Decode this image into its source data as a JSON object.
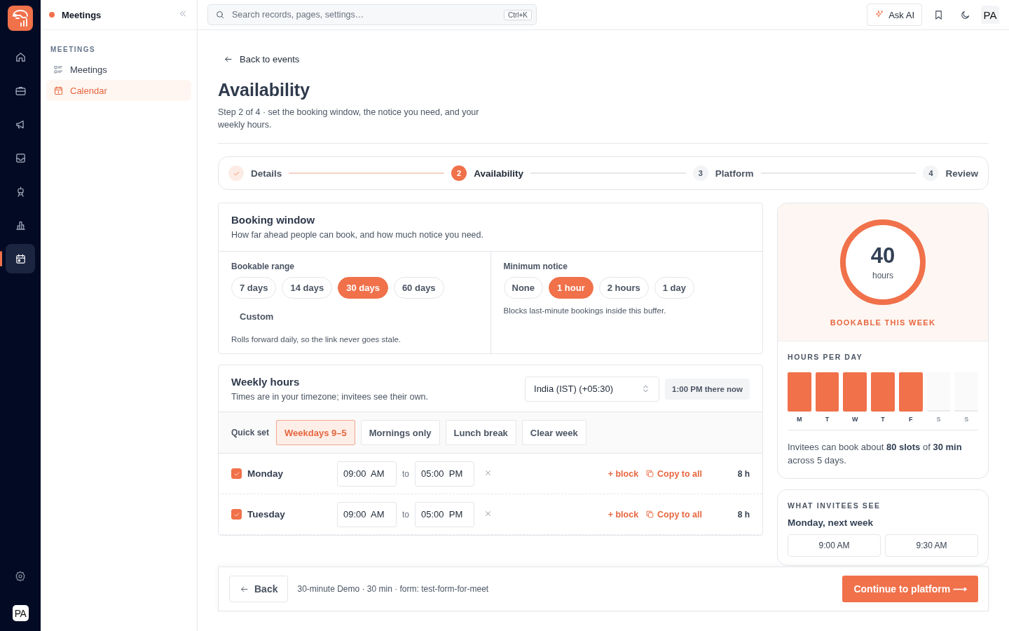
{
  "rail": {
    "items": [
      {
        "selected": false
      },
      {
        "selected": false
      },
      {
        "selected": false
      },
      {
        "selected": false
      },
      {
        "selected": false
      },
      {
        "selected": false
      },
      {
        "selected": true
      }
    ],
    "avatar": "PA"
  },
  "sidebar": {
    "title": "Meetings",
    "section": "MEETINGS",
    "items": [
      {
        "label": "Meetings",
        "selected": false
      },
      {
        "label": "Calendar",
        "selected": true
      }
    ]
  },
  "topbar": {
    "search": {
      "placeholder": "Search records, pages, settings…"
    },
    "shortcut": "Ctrl+K",
    "ask_ai": "Ask AI",
    "avatar": "PA"
  },
  "page": {
    "back_link": "Back to events",
    "title": "Availability",
    "subtitle": "Step 2 of 4 · set the booking window, the notice you need, and your weekly hours."
  },
  "stepper": [
    {
      "label": "Details",
      "kind": "done"
    },
    {
      "number": "2",
      "label": "Availability",
      "kind": "current"
    },
    {
      "number": "3",
      "label": "Platform",
      "kind": "upcoming"
    },
    {
      "number": "4",
      "label": "Review",
      "kind": "upcoming"
    }
  ],
  "booking_window": {
    "title": "Booking window",
    "description": "How far ahead people can book, and how much notice you need.",
    "range": {
      "label": "Bookable range",
      "options": [
        {
          "label": "7 days",
          "selected": false
        },
        {
          "label": "14 days",
          "selected": false
        },
        {
          "label": "30 days",
          "selected": true
        },
        {
          "label": "60 days",
          "selected": false
        },
        {
          "label": "Custom",
          "selected": false,
          "kind": "text"
        }
      ],
      "note": "Rolls forward daily, so the link never goes stale."
    },
    "notice": {
      "label": "Minimum notice",
      "options": [
        {
          "label": "None",
          "selected": false
        },
        {
          "label": "1 hour",
          "selected": true
        },
        {
          "label": "2 hours",
          "selected": false
        },
        {
          "label": "1 day",
          "selected": false
        }
      ],
      "note": "Blocks last-minute bookings inside this buffer."
    }
  },
  "weekly_hours": {
    "title": "Weekly hours",
    "description": "Times are in your timezone; invitees see their own.",
    "timezone": "India (IST) (+05:30)",
    "local_time": "1:00 PM there now",
    "quick_set": {
      "label": "Quick set",
      "options": [
        {
          "label": "Weekdays 9–5",
          "selected": true
        },
        {
          "label": "Mornings only",
          "selected": false
        },
        {
          "label": "Lunch break",
          "selected": false
        },
        {
          "label": "Clear week",
          "selected": false
        }
      ]
    },
    "days": [
      {
        "name": "Monday",
        "checked": true,
        "from": "09:00  AM",
        "to_word": "to",
        "to": "05:00  PM",
        "add_block": "+ block",
        "copy": "Copy to all",
        "total": "8 h"
      },
      {
        "name": "Tuesday",
        "checked": true,
        "from": "09:00  AM",
        "to_word": "to",
        "to": "05:00  PM",
        "add_block": "+ block",
        "copy": "Copy to all",
        "total": "8 h"
      }
    ]
  },
  "summary": {
    "ring": {
      "value": "40",
      "unit": "hours",
      "level": 1
    },
    "caption": "BOOKABLE THIS WEEK",
    "hours_title": "HOURS PER DAY",
    "days": [
      {
        "label": "M",
        "level": 1
      },
      {
        "label": "T",
        "level": 1
      },
      {
        "label": "W",
        "level": 1
      },
      {
        "label": "T",
        "level": 1
      },
      {
        "label": "F",
        "level": 1
      },
      {
        "label": "S",
        "level": 0
      },
      {
        "label": "S",
        "level": 0
      }
    ],
    "note": "Invitees can book about **80 slots** of **30 min** across 5 days."
  },
  "preview": {
    "title": "WHAT INVITEES SEE",
    "day": "Monday, next week",
    "slots": [
      "9:00 AM",
      "9:30 AM"
    ]
  },
  "footer": {
    "back": "Back",
    "summary": "30-minute Demo · 30 min · form: test-form-for-meet",
    "continue": "Continue to platform ⟶"
  }
}
